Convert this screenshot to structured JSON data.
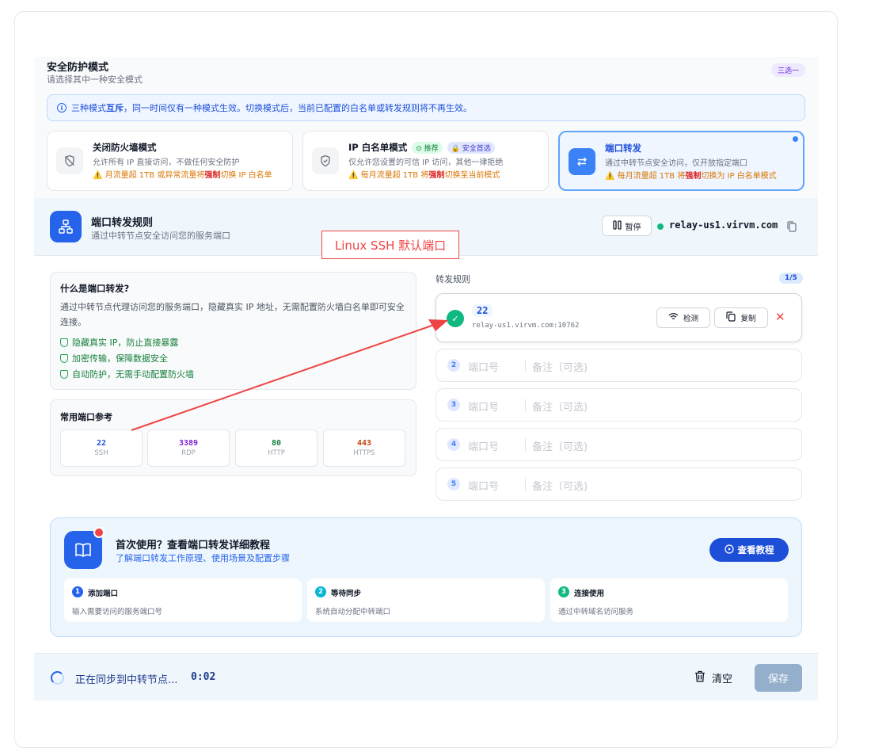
{
  "modes": {
    "title": "安全防护模式",
    "subtitle": "请选择其中一种安全模式",
    "badge": "三选一",
    "notice_pre": "三种模式",
    "notice_bold": "互斥",
    "notice_post": "，同一时间仅有一种模式生效。切换模式后，当前已配置的白名单或转发规则将不再生效。",
    "cards": [
      {
        "name": "关闭防火墙模式",
        "desc": "允许所有 IP 直接访问，不做任何安全防护",
        "warn_pre": "⚠️ 月流量超 1TB 或异常流量将",
        "warn_bold": "强制",
        "warn_post": "切换 IP 白名单"
      },
      {
        "name": "IP 白名单模式",
        "tag1": "⊙ 推荐",
        "tag2": "🔒 安全首选",
        "desc": "仅允许您设置的可信 IP 访问，其他一律拒绝",
        "warn_pre": "⚠️ 每月流量超 1TB 将",
        "warn_bold": "强制",
        "warn_post": "切换至当前模式"
      },
      {
        "name": "端口转发",
        "desc": "通过中转节点安全访问，仅开放指定端口",
        "warn_pre": "⚠️ 每月流量超 1TB 将",
        "warn_bold": "强制",
        "warn_post": "切换为 IP 白名单模式"
      }
    ]
  },
  "pf": {
    "title": "端口转发规则",
    "subtitle": "通过中转节点安全访问您的服务端口",
    "pause_label": "暂停",
    "domain": "relay-us1.virvm.com"
  },
  "info": {
    "title": "什么是端口转发?",
    "text": "通过中转节点代理访问您的服务端口，隐藏真实 IP 地址，无需配置防火墙白名单即可安全连接。",
    "features": [
      "隐藏真实 IP，防止直接暴露",
      "加密传输，保障数据安全",
      "自动防护，无需手动配置防火墙"
    ]
  },
  "ports": {
    "title": "常用端口参考",
    "items": [
      {
        "num": "22",
        "label": "SSH",
        "color": "#1d4ed8"
      },
      {
        "num": "3389",
        "label": "RDP",
        "color": "#7e22ce"
      },
      {
        "num": "80",
        "label": "HTTP",
        "color": "#15803d"
      },
      {
        "num": "443",
        "label": "HTTPS",
        "color": "#c2410c"
      }
    ]
  },
  "rules": {
    "label": "转发规则",
    "count": "1/5",
    "first": {
      "port": "22",
      "relay": "relay-us1.virvm.com:10762",
      "detect": "检测",
      "copy": "复制"
    },
    "empty": [
      {
        "idx": "2",
        "port_ph": "端口号",
        "note_ph": "备注（可选)"
      },
      {
        "idx": "3",
        "port_ph": "端口号",
        "note_ph": "备注（可选)"
      },
      {
        "idx": "4",
        "port_ph": "端口号",
        "note_ph": "备注（可选)"
      },
      {
        "idx": "5",
        "port_ph": "端口号",
        "note_ph": "备注（可选)"
      }
    ]
  },
  "annotation": "Linux SSH 默认端口",
  "tutorial": {
    "title": "首次使用？查看端口转发详细教程",
    "subtitle": "了解端口转发工作原理、使用场景及配置步骤",
    "button": "查看教程",
    "steps": [
      {
        "num": "1",
        "title": "添加端口",
        "desc": "输入需要访问的服务端口号",
        "color": "#2563eb"
      },
      {
        "num": "2",
        "title": "等待同步",
        "desc": "系统自动分配中转端口",
        "color": "#06b6d4"
      },
      {
        "num": "3",
        "title": "连接使用",
        "desc": "通过中转域名访问服务",
        "color": "#10b981"
      }
    ]
  },
  "footer": {
    "sync_text": "正在同步到中转节点...",
    "sync_time": "0:02",
    "clear": "清空",
    "save": "保存"
  }
}
